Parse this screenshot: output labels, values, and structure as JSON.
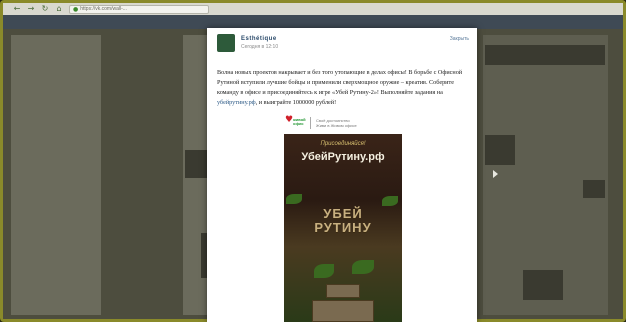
{
  "browser": {
    "url": "https://vk.com/wall-...",
    "icons": {
      "back": "back-arrow-icon",
      "forward": "forward-arrow-icon",
      "reload": "reload-icon",
      "home": "home-icon",
      "lock": "lock-icon"
    }
  },
  "post": {
    "author": "Esthétique",
    "time": "Сегодня в 12:10",
    "close_label": "Закрыть",
    "text_before_link": "Волна новых проектов накрывает и без того утопающие в делах офисы! В борьбе с Офисной Рутиной вступили лучшие бойцы и применили сверхмощное оружие – креатив. Соберите команду в офисе и присоединяйтесь к игре «Убей Рутину-2»! Выполняйте задания на ",
    "link": "убейрутину.рф",
    "text_after_link": ", и выиграйте 1000000 рублей!"
  },
  "promo": {
    "brand": "живой офис",
    "note_line1": "Своё достоинство",
    "note_line2": "Живи в Живом офисе"
  },
  "poster": {
    "join": "Присоединяйся!",
    "url": "УбейРутину.рф",
    "game_line1": "УБЕЙ",
    "game_line2": "РУТИНУ"
  },
  "colors": {
    "accent": "#2a5885",
    "brand_red": "#d0202a",
    "frame": "#8a8a2a"
  }
}
